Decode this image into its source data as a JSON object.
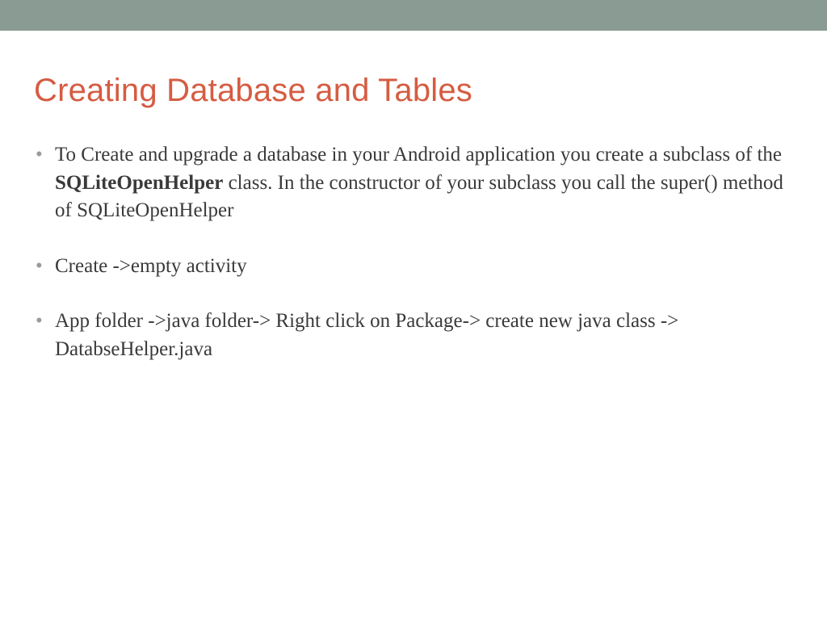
{
  "slide": {
    "title": "Creating Database and Tables",
    "bullets": [
      {
        "pre": "To Create and upgrade a database in your Android application you create a subclass of the ",
        "bold": "SQLiteOpenHelper",
        "post": " class. In the constructor of your subclass you call the super() method of SQLiteOpenHelper"
      },
      {
        "text": "Create ->empty activity"
      },
      {
        "text": "App folder ->java folder-> Right click on Package-> create new java class -> DatabseHelper.java"
      }
    ]
  }
}
